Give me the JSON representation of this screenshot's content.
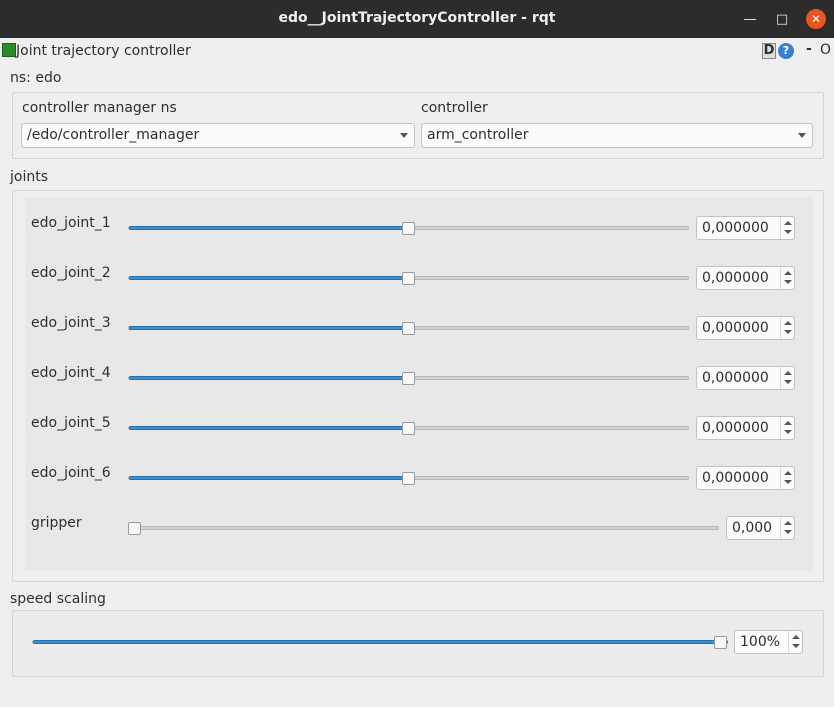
{
  "window": {
    "title": "edo__JointTrajectoryController - rqt",
    "minimize_icon": "minimize-icon",
    "maximize_icon": "maximize-icon",
    "close_icon": "close-icon"
  },
  "plugin": {
    "title": "Joint trajectory controller",
    "icon": "trajectory-plot-icon",
    "d_label": "D",
    "help_label": "?",
    "dash_label": "-",
    "o_label": "O"
  },
  "namespace": "ns: edo",
  "controller_manager": {
    "label": "controller manager ns",
    "value": "/edo/controller_manager"
  },
  "controller": {
    "label": "controller",
    "value": "arm_controller"
  },
  "joints_label": "joints",
  "joints": [
    {
      "name": "edo_joint_1",
      "value": "0,000000",
      "level": 0.5
    },
    {
      "name": "edo_joint_2",
      "value": "0,000000",
      "level": 0.5
    },
    {
      "name": "edo_joint_3",
      "value": "0,000000",
      "level": 0.5
    },
    {
      "name": "edo_joint_4",
      "value": "0,000000",
      "level": 0.5
    },
    {
      "name": "edo_joint_5",
      "value": "0,000000",
      "level": 0.5
    },
    {
      "name": "edo_joint_6",
      "value": "0,000000",
      "level": 0.5
    }
  ],
  "gripper": {
    "name": "gripper",
    "value": "0,000",
    "level": 0.0
  },
  "speed_scaling": {
    "label": "speed scaling",
    "value": "100%",
    "level": 1.0
  },
  "colors": {
    "accent": "#3d8fd1",
    "close_button": "#e95420",
    "titlebar": "#2c2c2c"
  }
}
